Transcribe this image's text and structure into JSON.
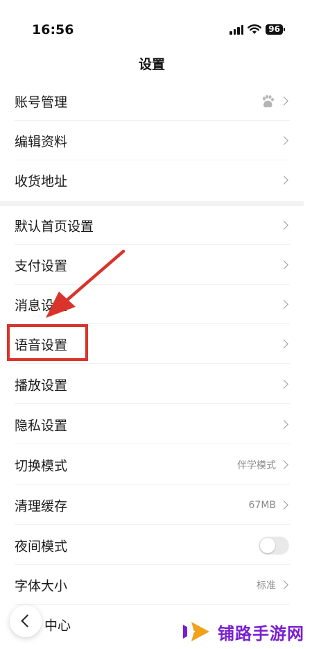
{
  "status_bar": {
    "time": "16:56",
    "battery": "96",
    "icons": [
      "signal-icon",
      "wifi-icon",
      "battery-icon"
    ]
  },
  "header": {
    "title": "设置"
  },
  "settings": {
    "account": {
      "label": "账号管理",
      "icon": "baidu-paw-icon"
    },
    "edit_profile": {
      "label": "编辑资料"
    },
    "address": {
      "label": "收货地址"
    },
    "default_home": {
      "label": "默认首页设置"
    },
    "payment": {
      "label": "支付设置"
    },
    "message": {
      "label": "消息设置"
    },
    "voice": {
      "label": "语音设置"
    },
    "playback": {
      "label": "播放设置"
    },
    "privacy": {
      "label": "隐私设置"
    },
    "switch_mode": {
      "label": "切换模式",
      "value": "伴学模式"
    },
    "clear_cache": {
      "label": "清理缓存",
      "value": "67MB"
    },
    "night_mode": {
      "label": "夜间模式",
      "enabled": false
    },
    "font_size": {
      "label": "字体大小",
      "value": "标准"
    },
    "help_center": {
      "label": "中心"
    }
  },
  "annotation": {
    "color": "#d9342b",
    "highlighted_item": "语音设置"
  },
  "watermark": {
    "text": "铺路手游网",
    "color": "#7a1fd0"
  }
}
